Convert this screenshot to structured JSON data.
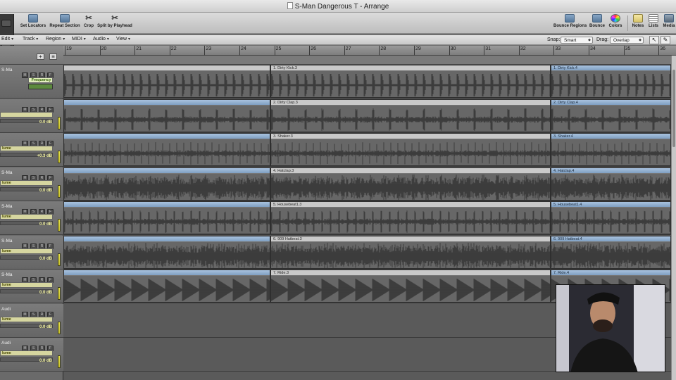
{
  "window": {
    "title": "S-Man Dangerous T - Arrange"
  },
  "toolbar": {
    "set_locators": "Set Locators",
    "repeat_section": "Repeat Section",
    "crop": "Crop",
    "split_by_playhead": "Split by Playhead",
    "bounce_regions": "Bounce Regions",
    "bounce": "Bounce",
    "colors": "Colors",
    "notes": "Notes",
    "lists": "Lists",
    "media": "Media"
  },
  "menubar": {
    "edit": "Edit",
    "track": "Track",
    "region": "Region",
    "midi": "MIDI",
    "audio": "Audio",
    "view": "View",
    "snap_label": "Snap:",
    "snap_value": "Smart",
    "drag_label": "Drag:",
    "drag_value": "Overlap"
  },
  "ruler": {
    "bars": [
      "19",
      "20",
      "21",
      "22",
      "23",
      "24",
      "25",
      "26",
      "27",
      "28",
      "29",
      "30",
      "31",
      "32",
      "33",
      "34",
      "35",
      "36"
    ]
  },
  "tracks": [
    {
      "name": "S-Ma",
      "param": "Frequency",
      "value": "",
      "left_region": "",
      "region_a": "1. Dirty Kick.3",
      "region_b": "1. Dirty Kick.4",
      "color": "#c9c9c9"
    },
    {
      "name": "",
      "param": "",
      "value": "0.0 dB",
      "left_region": "",
      "region_a": "2. Dirty Clap.3",
      "region_b": "2. Dirty Clap.4"
    },
    {
      "name": "",
      "param": "lume",
      "value": "+0.3 dB",
      "left_region": "",
      "region_a": "3. Shaker.3",
      "region_b": "3. Shaker.4"
    },
    {
      "name": "S-Ma",
      "param": "lume",
      "value": "0.0 dB",
      "left_region": "",
      "region_a": "4. Hatclap.3",
      "region_b": "4. Hatclap.4"
    },
    {
      "name": "S-Ma",
      "param": "lume",
      "value": "0.0 dB",
      "left_region": "",
      "region_a": "5. Housebeat1.3",
      "region_b": "5. Housebeat1.4"
    },
    {
      "name": "S-Ma",
      "param": "lume",
      "value": "0.0 dB",
      "left_region": "",
      "region_a": "6. 909 Hatbeat.3",
      "region_b": "6. 909 Hatbeat.4"
    },
    {
      "name": "S-Ma",
      "param": "lume",
      "value": "0.0 dB",
      "left_region": "",
      "region_a": "7. Ride.3",
      "region_b": "7. Ride.4"
    },
    {
      "name": "Audi",
      "param": "lume",
      "value": "0.0 dB",
      "left_region": "",
      "region_a": "",
      "region_b": ""
    },
    {
      "name": "Audi",
      "param": "lume",
      "value": "0.0 dB",
      "left_region": "",
      "region_a": "",
      "region_b": ""
    }
  ],
  "colors": {
    "accent_region": "#8aaed3",
    "automation": "#35c27a",
    "meter": "#e6e24a"
  },
  "webcam": {
    "description_hidden": ""
  }
}
